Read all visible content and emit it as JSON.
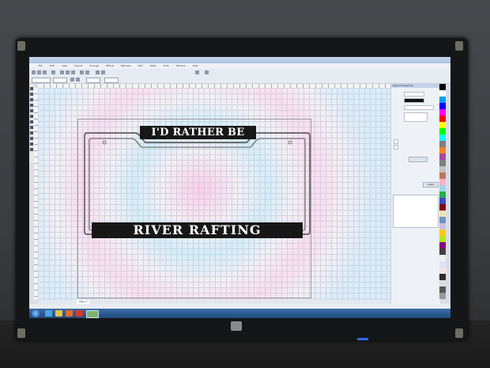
{
  "menu": {
    "items": [
      "File",
      "Edit",
      "View",
      "Layout",
      "Arrange",
      "Effects",
      "Bitmaps",
      "Text",
      "Table",
      "Tools",
      "Window",
      "Help"
    ]
  },
  "artwork": {
    "top_text": "I'D RATHER BE",
    "bottom_text": "RIVER RAFTING"
  },
  "docker": {
    "title": "Object Properties",
    "apply_label": "Apply"
  },
  "page_tab": "Page 1",
  "colors": {
    "artwork_fill": "#171717",
    "artwork_text": "#ffffff",
    "taskbar": "#1f4b7e",
    "palette": [
      "#000000",
      "#ffffff",
      "#00a2e8",
      "#0000ff",
      "#ff00ff",
      "#ff0000",
      "#ffff00",
      "#00ff00",
      "#00ffff",
      "#808080",
      "#ff7f27",
      "#a349a4",
      "#7f7f7f",
      "#c3c3c3",
      "#b97a57",
      "#ffaec9",
      "#99d9ea",
      "#22b14c",
      "#3f48cc",
      "#880015",
      "#efe4b0",
      "#7092be",
      "#c8bfe7",
      "#ffc90e",
      "#b5e61d",
      "#880088",
      "#404040",
      "#f0f0f0",
      "#e0e0ff",
      "#ffe0e0",
      "#2a2a2a",
      "#dddddd",
      "#555555",
      "#999999"
    ]
  },
  "icons": [
    "start-orb-icon",
    "ie-icon",
    "explorer-icon",
    "firefox-icon",
    "media-icon",
    "coreldraw-icon"
  ]
}
